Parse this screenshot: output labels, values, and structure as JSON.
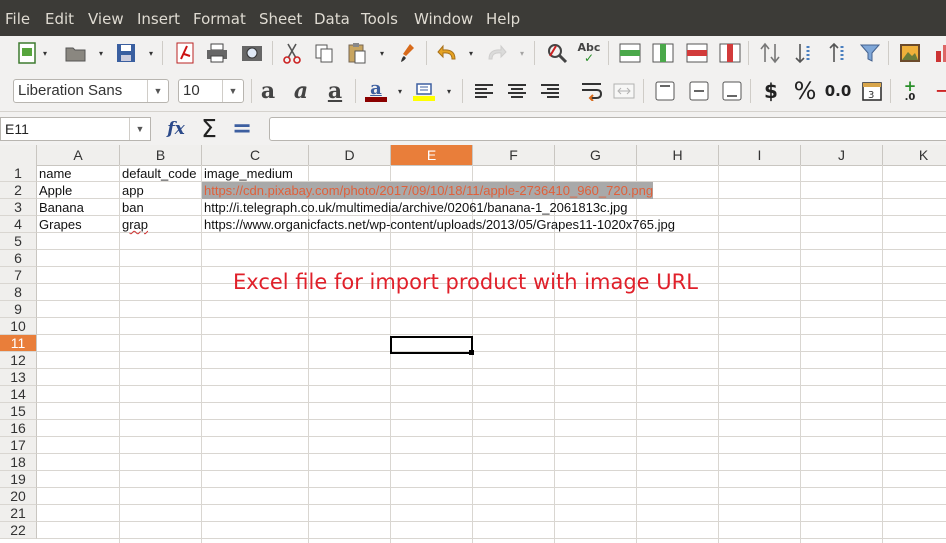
{
  "menu": [
    "File",
    "Edit",
    "View",
    "Insert",
    "Format",
    "Sheet",
    "Data",
    "Tools",
    "Window",
    "Help"
  ],
  "toolbar": {
    "font_name": "Liberation Sans",
    "font_size": "10",
    "currency_symbol": "$",
    "percent_symbol": "%",
    "number_format": "0.0",
    "spelling_label": "Abc",
    "bold_glyph": "a",
    "italic_glyph": "a",
    "underline_glyph": "a",
    "font_color_glyph": "a",
    "colors": {
      "font_color": "#8b0000",
      "highlight": "#ffff00",
      "accent": "#e97e3a",
      "annotation": "#e0202a"
    }
  },
  "formula_bar": {
    "name_box": "E11",
    "function_wizard": "fx",
    "sum_symbol": "Σ",
    "equals_symbol": "=",
    "formula": ""
  },
  "sheet": {
    "columns": [
      "A",
      "B",
      "C",
      "D",
      "E",
      "F",
      "G",
      "H",
      "I",
      "J",
      "K"
    ],
    "active_column": "E",
    "rows": [
      "1",
      "2",
      "3",
      "4",
      "5",
      "6",
      "7",
      "8",
      "9",
      "10",
      "11",
      "12",
      "13",
      "14",
      "15",
      "16",
      "17",
      "18",
      "19",
      "20",
      "21",
      "22"
    ],
    "active_row": "11",
    "cells": {
      "A1": "name",
      "B1": "default_code",
      "C1": "image_medium",
      "A2": "Apple",
      "B2": "app",
      "C2": "https://cdn.pixabay.com/photo/2017/09/10/18/11/apple-2736410_960_720.png",
      "A3": "Banana",
      "B3": "ban",
      "C3": "http://i.telegraph.co.uk/multimedia/archive/02061/banana-1_2061813c.jpg",
      "A4": "Grapes",
      "B4": "grap",
      "C4": "https://www.organicfacts.net/wp-content/uploads/2013/05/Grapes11-1020x765.jpg"
    },
    "annotation": "Excel file for import product with image URL"
  }
}
